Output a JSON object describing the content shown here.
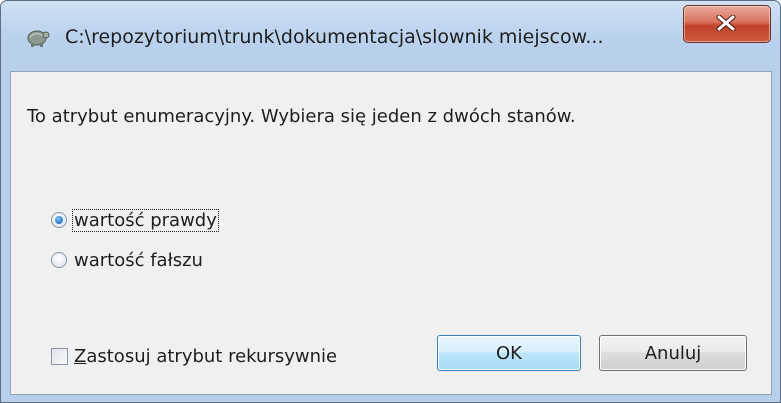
{
  "window": {
    "title": "C:\\repozytorium\\trunk\\dokumentacja\\slownik miejscow...",
    "icon": "tortoise-app-icon",
    "close_icon": "close-x-icon"
  },
  "dialog": {
    "description": "To atrybut enumeracyjny. Wybiera się jeden z dwóch stanów.",
    "options": [
      {
        "label": "wartość prawdy",
        "selected": true
      },
      {
        "label": "wartość fałszu",
        "selected": false
      }
    ],
    "recursive": {
      "accel": "Z",
      "rest": "astosuj atrybut rekursywnie",
      "checked": false
    },
    "ok_label": "OK",
    "cancel_label": "Anuluj"
  },
  "colors": {
    "frame": "#b9d1ec",
    "client": "#f0f0f0",
    "close_button": "#c7503a",
    "ok_border": "#3c7fb1"
  }
}
